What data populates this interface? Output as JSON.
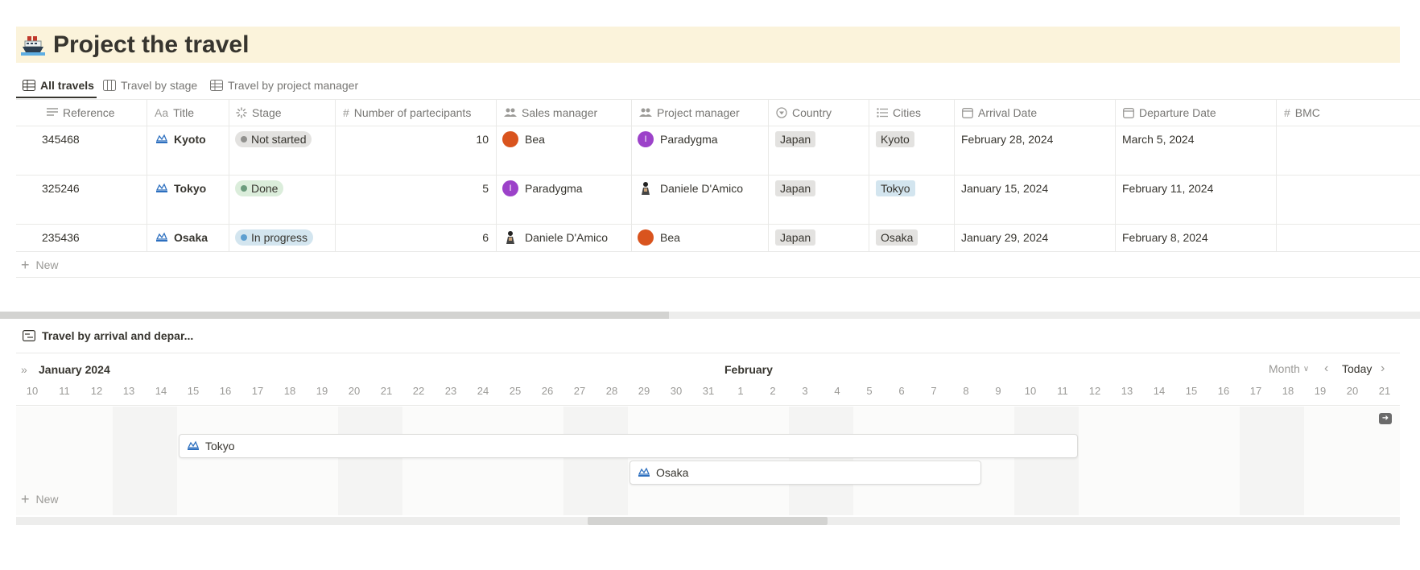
{
  "page": {
    "title": "Project the travel",
    "title_icon": "ship-icon"
  },
  "views": {
    "tabs": [
      {
        "label": "All travels",
        "icon": "table-icon",
        "active": true
      },
      {
        "label": "Travel by stage",
        "icon": "board-icon",
        "active": false
      },
      {
        "label": "Travel by project manager",
        "icon": "table-icon",
        "active": false
      }
    ]
  },
  "table": {
    "columns": [
      {
        "label": "Reference",
        "icon": "text-icon"
      },
      {
        "label": "Title",
        "icon": "aa-icon"
      },
      {
        "label": "Stage",
        "icon": "status-icon"
      },
      {
        "label": "Number of partecipants",
        "icon": "hash-icon"
      },
      {
        "label": "Sales manager",
        "icon": "people-icon"
      },
      {
        "label": "Project manager",
        "icon": "people-icon"
      },
      {
        "label": "Country",
        "icon": "select-icon"
      },
      {
        "label": "Cities",
        "icon": "list-icon"
      },
      {
        "label": "Arrival Date",
        "icon": "calendar-icon"
      },
      {
        "label": "Departure Date",
        "icon": "calendar-icon"
      },
      {
        "label": "BMC",
        "icon": "hash-icon"
      }
    ],
    "title_prefix": "Aa",
    "rows": [
      {
        "reference": "345468",
        "title": "Kyoto",
        "stage": "Not started",
        "participants": "10",
        "sales_manager": "Bea",
        "project_manager": "Paradygma",
        "country": "Japan",
        "city": "Kyoto",
        "arrival": "February 28, 2024",
        "departure": "March 5, 2024"
      },
      {
        "reference": "325246",
        "title": "Tokyo",
        "stage": "Done",
        "participants": "5",
        "sales_manager": "Paradygma",
        "project_manager": "Daniele D'Amico",
        "country": "Japan",
        "city": "Tokyo",
        "arrival": "January 15, 2024",
        "departure": "February 11, 2024"
      },
      {
        "reference": "235436",
        "title": "Osaka",
        "stage": "In progress",
        "participants": "6",
        "sales_manager": "Daniele D'Amico",
        "project_manager": "Bea",
        "country": "Japan",
        "city": "Osaka",
        "arrival": "January 29, 2024",
        "departure": "February 8, 2024"
      }
    ],
    "paradygma_initial": "I",
    "new_label": "New"
  },
  "timeline": {
    "view_title": "Travel by arrival and depar...",
    "month_label": "January 2024",
    "next_month_label": "February",
    "scale_label": "Month",
    "today_label": "Today",
    "days": [
      "10",
      "11",
      "12",
      "13",
      "14",
      "15",
      "16",
      "17",
      "18",
      "19",
      "20",
      "21",
      "22",
      "23",
      "24",
      "25",
      "26",
      "27",
      "28",
      "29",
      "30",
      "31",
      "1",
      "2",
      "3",
      "4",
      "5",
      "6",
      "7",
      "8",
      "9",
      "10",
      "11",
      "12",
      "13",
      "14",
      "15",
      "16",
      "17",
      "18",
      "19",
      "20",
      "21"
    ],
    "bars": [
      {
        "title": "Tokyo"
      },
      {
        "title": "Osaka"
      }
    ],
    "new_label": "New"
  },
  "colors": {
    "banner": "#fbf3db",
    "not_started": "#e3e2e0",
    "done": "#dbeddb",
    "in_progress": "#d3e5ef",
    "tag_gray": "#e3e2e0",
    "tag_blue": "#d3e5ef",
    "paradygma_avatar": "#9c42c9",
    "bea_avatar": "#d9541e"
  }
}
